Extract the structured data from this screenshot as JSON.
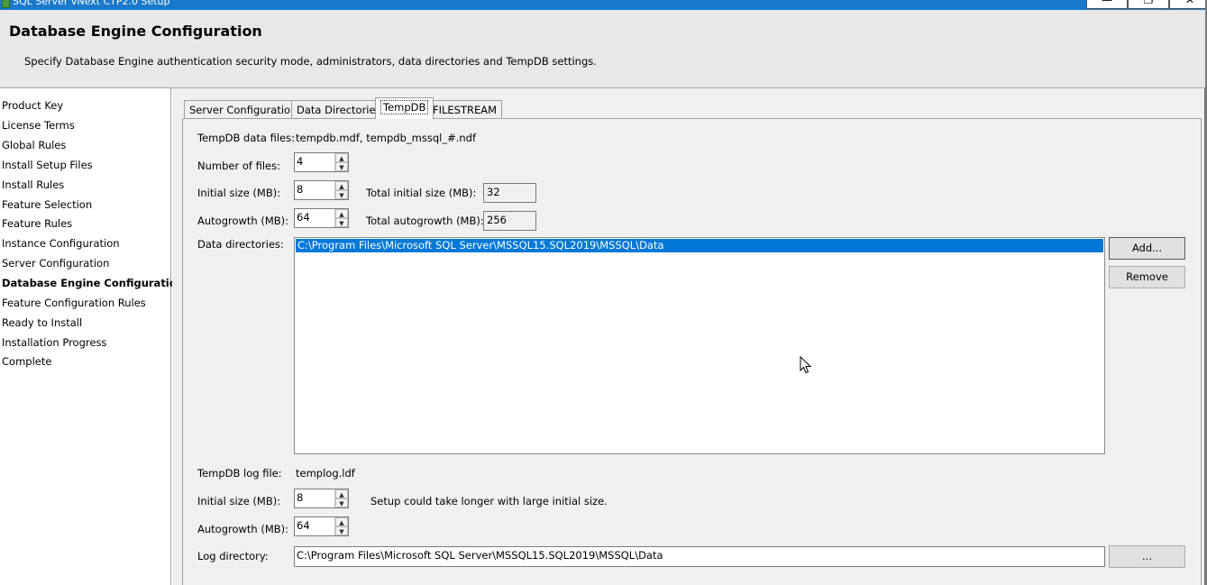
{
  "window": {
    "title": "SQL Server vNext CTP2.0 Setup",
    "minimize_glyph": "—",
    "restore_glyph": "❐",
    "close_glyph": "✕"
  },
  "header": {
    "title": "Database Engine Configuration",
    "subtitle": "Specify Database Engine authentication security mode, administrators, data directories and TempDB settings."
  },
  "sidebar": {
    "steps": [
      {
        "label": "Product Key"
      },
      {
        "label": "License Terms"
      },
      {
        "label": "Global Rules"
      },
      {
        "label": "Install Setup Files"
      },
      {
        "label": "Install Rules"
      },
      {
        "label": "Feature Selection"
      },
      {
        "label": "Feature Rules"
      },
      {
        "label": "Instance Configuration"
      },
      {
        "label": "Server Configuration"
      },
      {
        "label": "Database Engine Configuration",
        "active": true
      },
      {
        "label": "Feature Configuration Rules"
      },
      {
        "label": "Ready to Install"
      },
      {
        "label": "Installation Progress"
      },
      {
        "label": "Complete"
      }
    ]
  },
  "tabs": [
    {
      "label": "Server Configuration"
    },
    {
      "label": "Data Directories"
    },
    {
      "label": "TempDB",
      "selected": true
    },
    {
      "label": "FILESTREAM"
    }
  ],
  "tempdb": {
    "data_files_label": "TempDB data files:",
    "data_files_value": "tempdb.mdf, tempdb_mssql_#.ndf",
    "num_files_label": "Number of files:",
    "num_files_value": "4",
    "initial_size_label": "Initial size (MB):",
    "initial_size_value": "8",
    "total_initial_label": "Total initial size (MB):",
    "total_initial_value": "32",
    "autogrowth_label": "Autogrowth (MB):",
    "autogrowth_value": "64",
    "total_autogrowth_label": "Total autogrowth (MB):",
    "total_autogrowth_value": "256",
    "data_dirs_label": "Data directories:",
    "data_dirs": [
      "C:\\Program Files\\Microsoft SQL Server\\MSSQL15.SQL2019\\MSSQL\\Data"
    ],
    "add_button": "Add...",
    "remove_button": "Remove",
    "log_file_label": "TempDB log file:",
    "log_file_value": "templog.ldf",
    "log_initial_size_label": "Initial size (MB):",
    "log_initial_size_value": "8",
    "log_warning": "Setup could take longer with large initial size.",
    "log_autogrowth_label": "Autogrowth (MB):",
    "log_autogrowth_value": "64",
    "log_dir_label": "Log directory:",
    "log_dir_value": "C:\\Program Files\\Microsoft SQL Server\\MSSQL15.SQL2019\\MSSQL\\Data",
    "browse_button": "..."
  },
  "spinner": {
    "up_glyph": "▲",
    "down_glyph": "▼"
  }
}
